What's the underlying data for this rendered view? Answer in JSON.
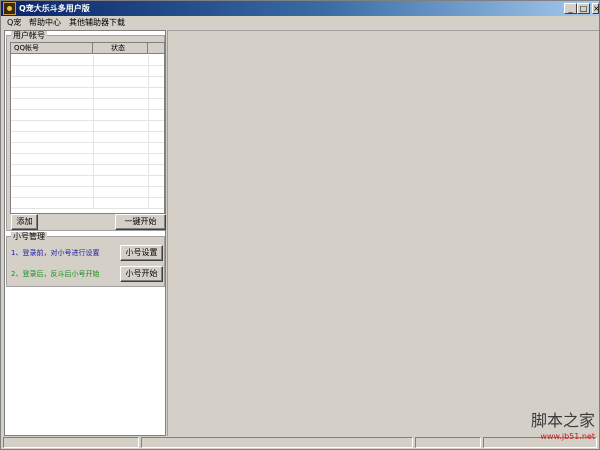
{
  "window": {
    "title": "Q宠大乐斗多用户版",
    "controls": {
      "minimize": "_",
      "maximize": "□",
      "close": "×"
    }
  },
  "menu": [
    "Q宠",
    "帮助中心",
    "其他辅助器下载"
  ],
  "accounts": {
    "group_title": "用户帐号",
    "columns": [
      "QQ帐号",
      "状态",
      ""
    ],
    "rows": [
      [
        "",
        ""
      ],
      [
        "",
        ""
      ],
      [
        "",
        ""
      ],
      [
        "",
        ""
      ],
      [
        "",
        ""
      ],
      [
        "",
        ""
      ],
      [
        "",
        ""
      ],
      [
        "",
        ""
      ],
      [
        "",
        ""
      ],
      [
        "",
        ""
      ],
      [
        "",
        ""
      ],
      [
        "",
        ""
      ],
      [
        "",
        ""
      ],
      [
        "",
        ""
      ]
    ],
    "add_button": "添加",
    "start_all_button": "一键开始"
  },
  "alt_manager": {
    "group_title": "小号管理",
    "line1": "1、登录前，对小号进行设置",
    "line2": "2、登录后，反斗后小号开始",
    "settings_button": "小号设置",
    "start_button": "小号开始",
    "line1_color": "#1a1aa8",
    "line2_color": "#1a8a1a"
  },
  "watermark": {
    "logo": "脚本之家",
    "url": "www.jb51.net"
  },
  "colors": {
    "title_bar_start": "#0a246a",
    "window_face": "#d4d0c8"
  }
}
